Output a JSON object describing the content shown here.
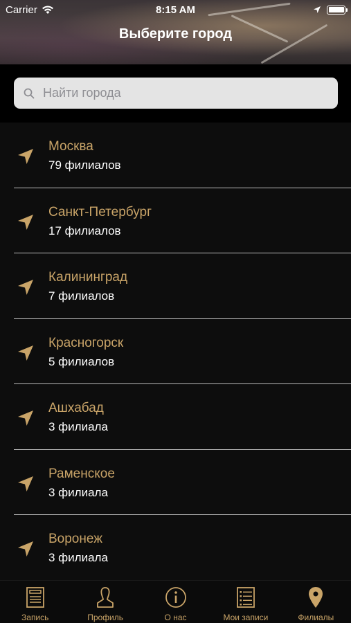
{
  "status_bar": {
    "carrier": "Carrier",
    "time": "8:15 AM"
  },
  "nav": {
    "title": "Выберите город"
  },
  "search": {
    "placeholder": "Найти города",
    "value": ""
  },
  "cities": [
    {
      "name": "Москва",
      "branches": "79 филиалов"
    },
    {
      "name": "Санкт-Петербург",
      "branches": "17 филиалов"
    },
    {
      "name": "Калининград",
      "branches": "7 филиалов"
    },
    {
      "name": "Красногорск",
      "branches": "5 филиалов"
    },
    {
      "name": "Ашхабад",
      "branches": "3 филиала"
    },
    {
      "name": "Раменское",
      "branches": "3 филиала"
    },
    {
      "name": "Воронеж",
      "branches": "3 филиала"
    }
  ],
  "tabs": [
    {
      "label": "Запись",
      "icon": "document-icon"
    },
    {
      "label": "Профиль",
      "icon": "person-icon"
    },
    {
      "label": "О нас",
      "icon": "info-icon"
    },
    {
      "label": "Мои записи",
      "icon": "list-icon"
    },
    {
      "label": "Филиалы",
      "icon": "map-pin-icon"
    }
  ],
  "colors": {
    "accent": "#c9a468",
    "background": "#0d0d0d",
    "divider": "#bdbdbd"
  }
}
